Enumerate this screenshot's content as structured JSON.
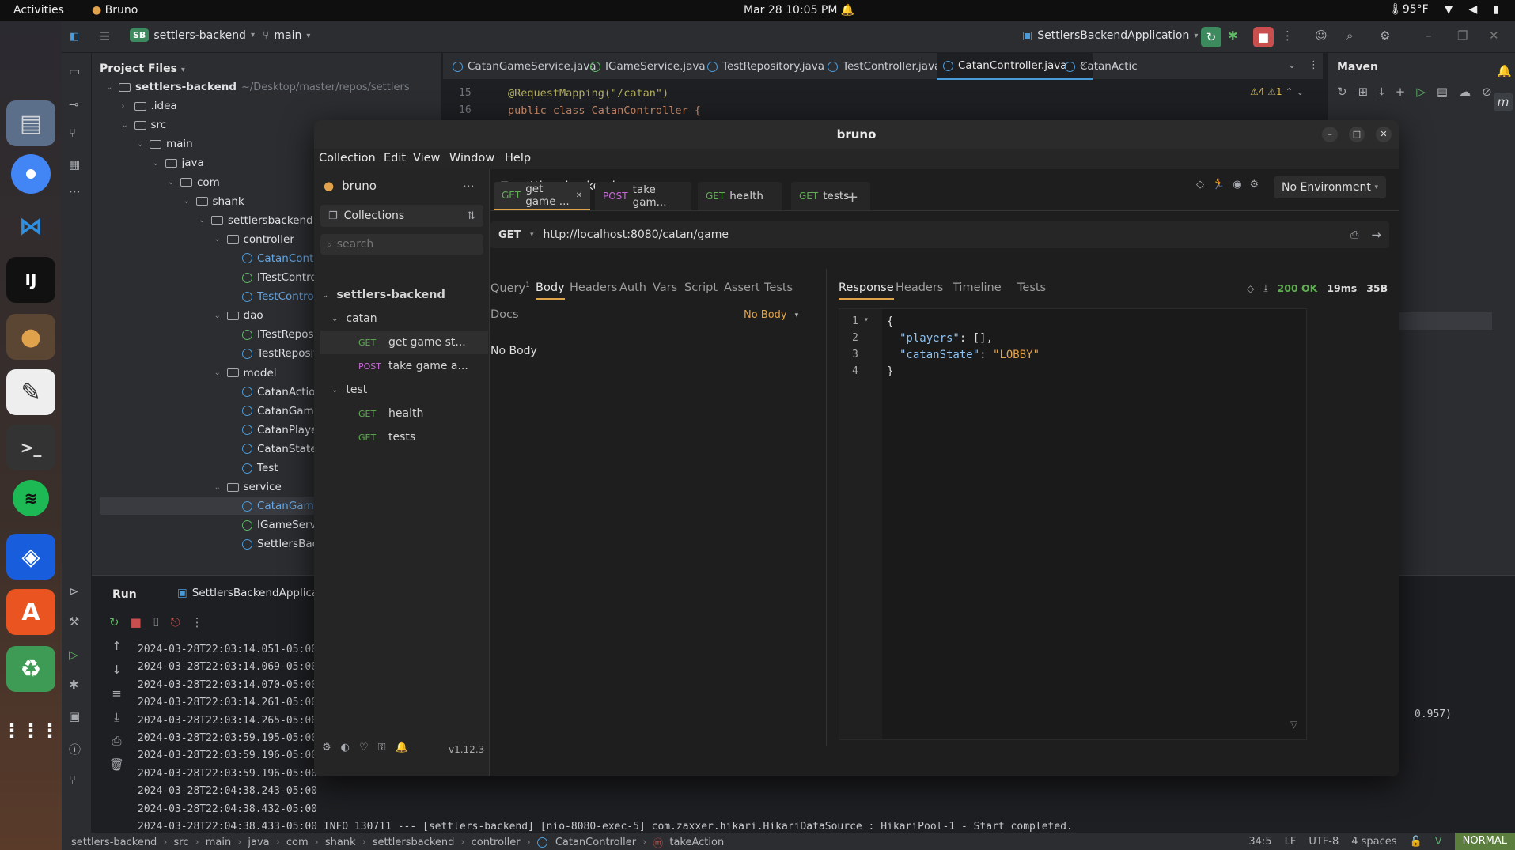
{
  "topbar": {
    "activities": "Activities",
    "app_name": "Bruno",
    "clock": "Mar 28  10:05 PM",
    "weather": "95°F"
  },
  "ide": {
    "project_badge": "SB",
    "project_name": "settlers-backend",
    "branch": "main",
    "run_config": "SettlersBackendApplication",
    "panel_title": "Project Files",
    "root_path": "~/Desktop/master/repos/settlers",
    "tree": [
      {
        "label": "settlers-backend",
        "depth": 0,
        "kind": "folder",
        "arrow": "v"
      },
      {
        "label": ".idea",
        "depth": 1,
        "kind": "folder",
        "arrow": ">"
      },
      {
        "label": "src",
        "depth": 1,
        "kind": "folder",
        "arrow": "v"
      },
      {
        "label": "main",
        "depth": 2,
        "kind": "folder",
        "arrow": "v"
      },
      {
        "label": "java",
        "depth": 3,
        "kind": "folder",
        "arrow": "v"
      },
      {
        "label": "com",
        "depth": 4,
        "kind": "folder",
        "arrow": "v"
      },
      {
        "label": "shank",
        "depth": 5,
        "kind": "folder",
        "arrow": "v"
      },
      {
        "label": "settlersbackend",
        "depth": 6,
        "kind": "folder",
        "arrow": "v"
      },
      {
        "label": "controller",
        "depth": 7,
        "kind": "folder",
        "arrow": "v"
      },
      {
        "label": "CatanContro",
        "depth": 8,
        "kind": "class",
        "arrow": ""
      },
      {
        "label": "ITestControl",
        "depth": 8,
        "kind": "interface",
        "arrow": ""
      },
      {
        "label": "TestControll",
        "depth": 8,
        "kind": "class",
        "arrow": ""
      },
      {
        "label": "dao",
        "depth": 7,
        "kind": "folder",
        "arrow": "v"
      },
      {
        "label": "ITestReposit",
        "depth": 8,
        "kind": "interface",
        "arrow": ""
      },
      {
        "label": "TestReposit",
        "depth": 8,
        "kind": "class",
        "arrow": ""
      },
      {
        "label": "model",
        "depth": 7,
        "kind": "folder",
        "arrow": "v"
      },
      {
        "label": "CatanAction",
        "depth": 8,
        "kind": "class",
        "arrow": ""
      },
      {
        "label": "CatanGame",
        "depth": 8,
        "kind": "class",
        "arrow": ""
      },
      {
        "label": "CatanPlayer",
        "depth": 8,
        "kind": "class",
        "arrow": ""
      },
      {
        "label": "CatanState",
        "depth": 8,
        "kind": "class",
        "arrow": ""
      },
      {
        "label": "Test",
        "depth": 8,
        "kind": "class",
        "arrow": ""
      },
      {
        "label": "service",
        "depth": 7,
        "kind": "folder",
        "arrow": "v"
      },
      {
        "label": "CatanGameS",
        "depth": 8,
        "kind": "class",
        "arrow": ""
      },
      {
        "label": "IGameServic",
        "depth": 8,
        "kind": "interface",
        "arrow": ""
      },
      {
        "label": "SettlersBack",
        "depth": 8,
        "kind": "class",
        "arrow": ""
      }
    ],
    "editor_tabs": [
      {
        "label": "CatanGameService.java"
      },
      {
        "label": "IGameService.java"
      },
      {
        "label": "TestRepository.java"
      },
      {
        "label": "TestController.java"
      },
      {
        "label": "CatanController.java"
      },
      {
        "label": "CatanActic"
      }
    ],
    "maven_label": "Maven",
    "warnings": "4",
    "weak_warnings": "1",
    "code": [
      {
        "num": "15",
        "text": "@RequestMapping(\"/catan\")"
      },
      {
        "num": "16",
        "text": "public class CatanController {"
      }
    ],
    "run_tab": "Run",
    "run_config_tab": "SettlersBackendApplication",
    "logs": [
      "2024-03-28T22:03:14.051-05:00",
      "2024-03-28T22:03:14.069-05:00",
      "2024-03-28T22:03:14.070-05:00",
      "2024-03-28T22:03:14.261-05:00",
      "2024-03-28T22:03:14.265-05:00",
      "2024-03-28T22:03:59.195-05:00",
      "2024-03-28T22:03:59.196-05:00",
      "2024-03-28T22:03:59.196-05:00",
      "2024-03-28T22:04:38.243-05:00",
      "2024-03-28T22:04:38.432-05:00",
      "2024-03-28T22:04:38.433-05:00  INFO 130711 --- [settlers-backend] [nio-8080-exec-5] com.zaxxer.hikari.HikariDataSource       : HikariPool-1 - Start completed."
    ],
    "log_side_value": "0.957)",
    "breadcrumb": [
      "settlers-backend",
      "src",
      "main",
      "java",
      "com",
      "shank",
      "settlersbackend",
      "controller",
      "CatanController",
      "takeAction"
    ],
    "status": {
      "position": "34:5",
      "line_sep": "LF",
      "encoding": "UTF-8",
      "indent": "4 spaces",
      "mode": "NORMAL"
    }
  },
  "bruno": {
    "title": "bruno",
    "menu": [
      "Collection",
      "Edit",
      "View",
      "Window",
      "Help"
    ],
    "app_label": "bruno",
    "collections_label": "Collections",
    "search_placeholder": "search",
    "collection_name": "settlers-backend",
    "folders": [
      {
        "name": "catan",
        "requests": [
          {
            "method": "GET",
            "label": "get game st..."
          },
          {
            "method": "POST",
            "label": "take game a..."
          }
        ]
      },
      {
        "name": "test",
        "requests": [
          {
            "method": "GET",
            "label": "health"
          },
          {
            "method": "GET",
            "label": "tests"
          }
        ]
      }
    ],
    "version": "v1.12.3",
    "workspace": "settlers-backend",
    "environment": "No Environment",
    "tabs": [
      {
        "method": "GET",
        "label": "get game ..."
      },
      {
        "method": "POST",
        "label": "take gam..."
      },
      {
        "method": "GET",
        "label": "health"
      },
      {
        "method": "GET",
        "label": "tests"
      }
    ],
    "method": "GET",
    "url": "http://localhost:8080/catan/game",
    "request_tabs": {
      "query": "Query",
      "query_count": "1",
      "body": "Body",
      "headers": "Headers",
      "auth": "Auth",
      "vars": "Vars",
      "script": "Script",
      "assert": "Assert",
      "tests": "Tests",
      "docs": "Docs"
    },
    "body_mode": "No Body",
    "body_empty": "No Body",
    "response_tabs": {
      "response": "Response",
      "headers": "Headers",
      "timeline": "Timeline",
      "tests": "Tests"
    },
    "status": "200 OK",
    "time": "19ms",
    "size": "35B",
    "response_lines": [
      {
        "num": "1",
        "text": "{"
      },
      {
        "num": "2",
        "key": "\"players\"",
        "rest": ": [],"
      },
      {
        "num": "3",
        "key": "\"catanState\"",
        "rest": ": ",
        "str": "\"LOBBY\""
      },
      {
        "num": "4",
        "text": "}"
      }
    ]
  }
}
